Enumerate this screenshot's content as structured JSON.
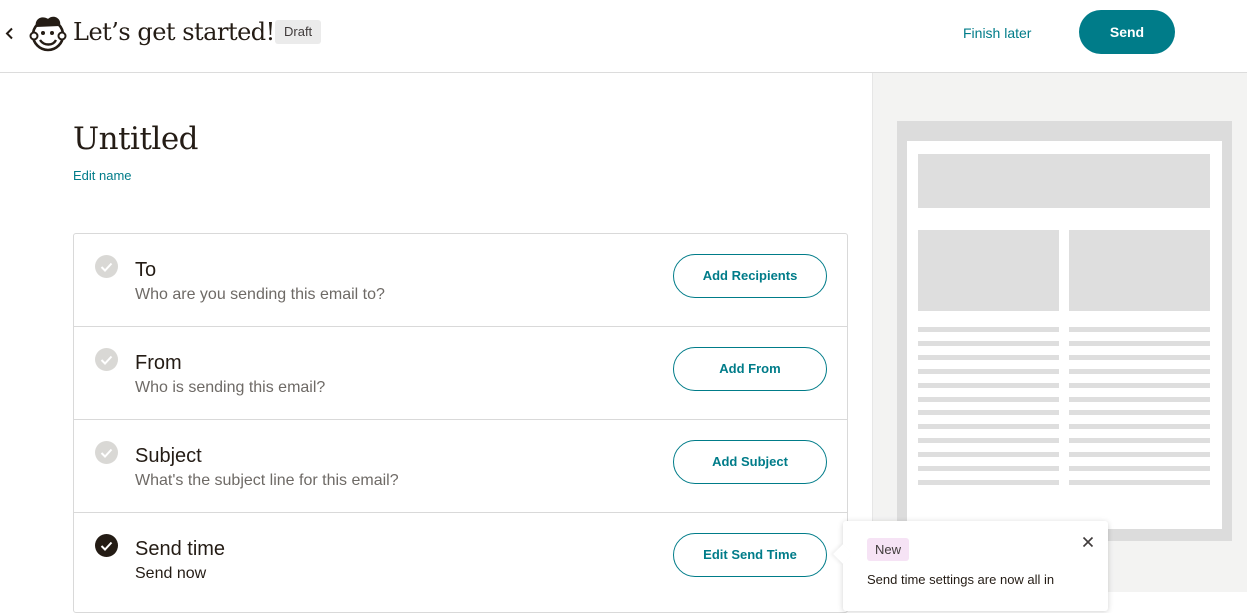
{
  "header": {
    "back_icon": "chevron-left-icon",
    "logo_icon": "freddie-logo-icon",
    "title": "Let’s get started!",
    "badge": "Draft",
    "finish_later": "Finish later",
    "send": "Send"
  },
  "campaign": {
    "name": "Untitled",
    "edit_name": "Edit name"
  },
  "checklist": [
    {
      "title": "To",
      "subtitle": "Who are you sending this email to?",
      "button": "Add Recipients",
      "complete": false
    },
    {
      "title": "From",
      "subtitle": "Who is sending this email?",
      "button": "Add From",
      "complete": false
    },
    {
      "title": "Subject",
      "subtitle": "What's the subject line for this email?",
      "button": "Add Subject",
      "complete": false
    },
    {
      "title": "Send time",
      "subtitle": "Send now",
      "button": "Edit Send Time",
      "complete": true
    }
  ],
  "popover": {
    "badge": "New",
    "text": "Send time settings are now all in",
    "close_icon": "close-icon"
  },
  "colors": {
    "accent": "#007c89",
    "text": "#241c15",
    "check_incomplete": "#d9d8d5",
    "check_complete": "#241c15",
    "new_badge": "#f6e3f5"
  }
}
